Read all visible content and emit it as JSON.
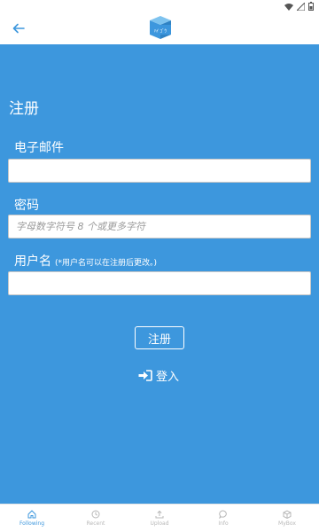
{
  "app_bar": {
    "logo_text": "ﾊｲ ｺﾞｳ"
  },
  "page": {
    "title": "注册"
  },
  "form": {
    "email": {
      "label": "电子邮件",
      "value": "",
      "placeholder": ""
    },
    "password": {
      "label": "密码",
      "value": "",
      "placeholder": "字母数字符号 8 个或更多字符"
    },
    "username": {
      "label": "用户名",
      "hint": "(*用户名可以在注册后更改。)",
      "value": "",
      "placeholder": ""
    }
  },
  "actions": {
    "register_label": "注册",
    "login_label": "登入"
  },
  "bottom_nav": {
    "items": [
      {
        "label": "Following",
        "icon": "home-icon",
        "active": true
      },
      {
        "label": "Recent",
        "icon": "clock-icon",
        "active": false
      },
      {
        "label": "Upload",
        "icon": "upload-icon",
        "active": false
      },
      {
        "label": "Info",
        "icon": "chat-icon",
        "active": false
      },
      {
        "label": "MyBox",
        "icon": "box-icon",
        "active": false
      }
    ]
  },
  "colors": {
    "primary": "#3d97dd",
    "background": "#3d97dd",
    "bar": "#ffffff",
    "inactive": "#b8b8b8"
  }
}
